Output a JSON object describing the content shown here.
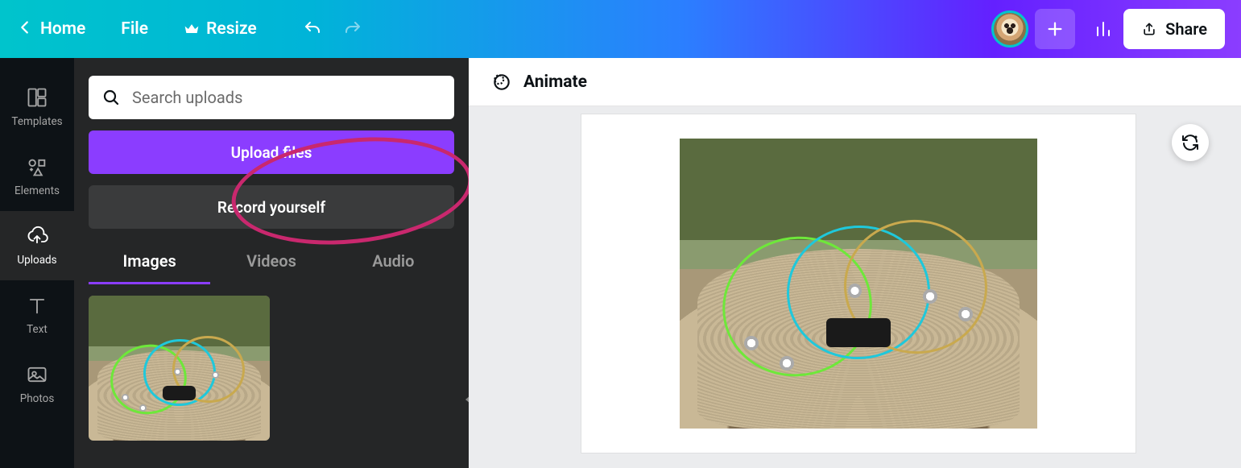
{
  "topbar": {
    "home": "Home",
    "file": "File",
    "resize": "Resize",
    "share": "Share"
  },
  "rail": {
    "templates": "Templates",
    "elements": "Elements",
    "uploads": "Uploads",
    "text": "Text",
    "photos": "Photos"
  },
  "panel": {
    "search_placeholder": "Search uploads",
    "upload_button": "Upload files",
    "record_button": "Record yourself",
    "tabs": {
      "images": "Images",
      "videos": "Videos",
      "audio": "Audio"
    }
  },
  "context": {
    "animate": "Animate"
  }
}
